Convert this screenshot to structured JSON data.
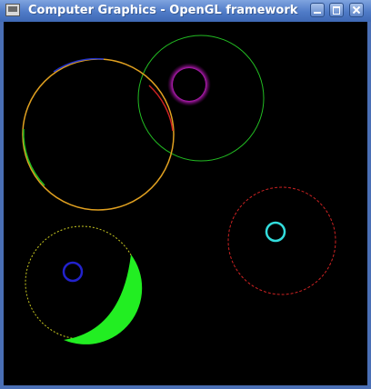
{
  "window": {
    "title": "Computer Graphics - OpenGL framework",
    "app_icon": "monitor-icon",
    "buttons": {
      "minimize": "minimize-icon",
      "maximize": "maximize-icon",
      "close": "close-icon"
    }
  },
  "scene": {
    "background": "#000000",
    "colors": {
      "green": "#22bb22",
      "orange": "#e0a020",
      "yellow": "#c8c820",
      "red": "#cc2222",
      "blue": "#2222cc",
      "magenta": "#ff33ff",
      "cyan": "#33dddd",
      "bright_green": "#22ee22"
    }
  }
}
